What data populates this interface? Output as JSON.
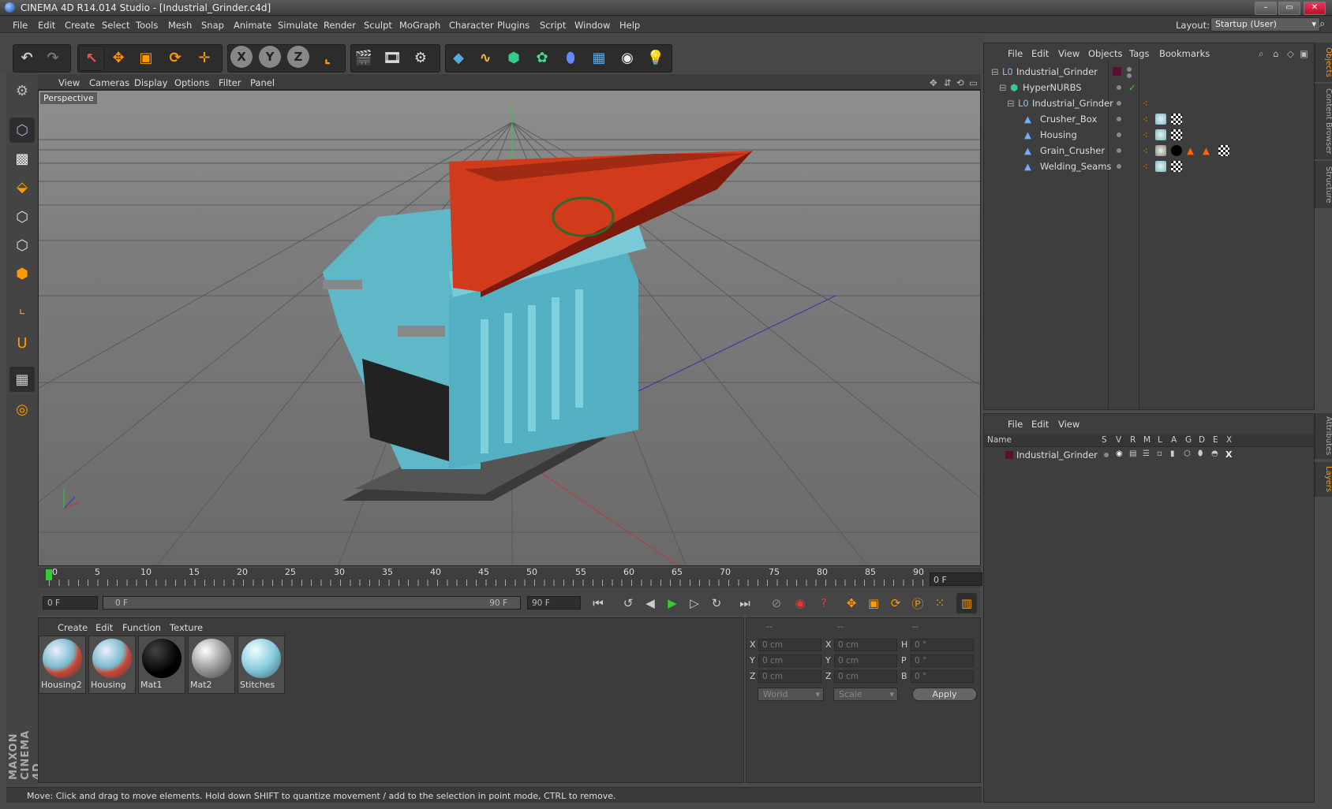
{
  "window": {
    "title": "CINEMA 4D R14.014 Studio - [Industrial_Grinder.c4d]"
  },
  "menu": [
    "File",
    "Edit",
    "Create",
    "Select",
    "Tools",
    "Mesh",
    "Snap",
    "Animate",
    "Simulate",
    "Render",
    "Sculpt",
    "MoGraph",
    "Character",
    "Plugins",
    "Script",
    "Window",
    "Help"
  ],
  "layout": {
    "label": "Layout:",
    "value": "Startup (User)"
  },
  "toolbar_axes": [
    "X",
    "Y",
    "Z"
  ],
  "viewport": {
    "menu": [
      "View",
      "Cameras",
      "Display",
      "Options",
      "Filter",
      "Panel"
    ],
    "label": "Perspective"
  },
  "timeline": {
    "ticks": [
      "0",
      "5",
      "10",
      "15",
      "20",
      "25",
      "30",
      "35",
      "40",
      "45",
      "50",
      "55",
      "60",
      "65",
      "70",
      "75",
      "80",
      "85",
      "90"
    ],
    "current_frame": "0 F",
    "start_field": "0 F",
    "range_start": "0 F",
    "range_end": "90 F",
    "end_field": "90 F"
  },
  "materials": {
    "menu": [
      "Create",
      "Edit",
      "Function",
      "Texture"
    ],
    "items": [
      "Housing2",
      "Housing",
      "Mat1",
      "Mat2",
      "Stitches"
    ]
  },
  "coordinates": {
    "headers": [
      "--",
      "--",
      "--"
    ],
    "rows": [
      {
        "a": "X",
        "av": "0 cm",
        "b": "X",
        "bv": "0 cm",
        "c": "H",
        "cv": "0 °"
      },
      {
        "a": "Y",
        "av": "0 cm",
        "b": "Y",
        "bv": "0 cm",
        "c": "P",
        "cv": "0 °"
      },
      {
        "a": "Z",
        "av": "0 cm",
        "b": "Z",
        "bv": "0 cm",
        "c": "B",
        "cv": "0 °"
      }
    ],
    "mode": "World",
    "scale": "Scale",
    "apply": "Apply"
  },
  "status": "Move: Click and drag to move elements. Hold down SHIFT to quantize movement / add to the selection in point mode, CTRL to remove.",
  "objects": {
    "menu": [
      "File",
      "Edit",
      "View",
      "Objects",
      "Tags",
      "Bookmarks"
    ],
    "items": [
      "Industrial_Grinder",
      "HyperNURBS",
      "Industrial_Grinder",
      "Crusher_Box",
      "Housing",
      "Grain_Crusher",
      "Welding_Seams"
    ]
  },
  "layers": {
    "menu": [
      "File",
      "Edit",
      "View"
    ],
    "columns": [
      "Name",
      "S",
      "V",
      "R",
      "M",
      "L",
      "A",
      "G",
      "D",
      "E",
      "X"
    ],
    "items": [
      "Industrial_Grinder"
    ]
  },
  "side_tabs": [
    "Objects",
    "Content Browser",
    "Structure",
    "Attributes",
    "Layers"
  ],
  "brand": "MAXON CINEMA 4D"
}
